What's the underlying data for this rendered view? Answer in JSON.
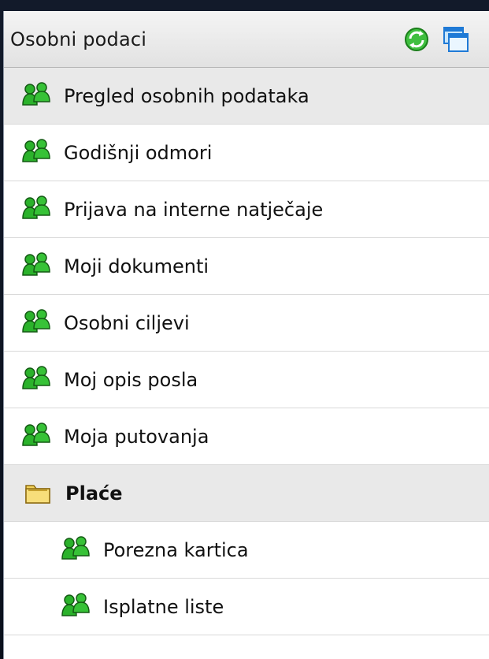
{
  "header": {
    "title": "Osobni podaci",
    "icons": [
      "refresh-icon",
      "window-icon"
    ]
  },
  "menu": {
    "items": [
      {
        "label": "Pregled osobnih podataka",
        "icon": "people-icon"
      },
      {
        "label": "Godišnji odmori",
        "icon": "people-icon"
      },
      {
        "label": "Prijava na interne natječaje",
        "icon": "people-icon"
      },
      {
        "label": "Moji dokumenti",
        "icon": "people-icon"
      },
      {
        "label": "Osobni ciljevi",
        "icon": "people-icon"
      },
      {
        "label": "Moj opis posla",
        "icon": "people-icon"
      },
      {
        "label": "Moja putovanja",
        "icon": "people-icon"
      }
    ],
    "folder": {
      "label": "Plaće",
      "icon": "folder-icon",
      "items": [
        {
          "label": "Porezna kartica",
          "icon": "people-icon"
        },
        {
          "label": "Isplatne liste",
          "icon": "people-icon"
        }
      ]
    }
  },
  "colors": {
    "header_bg": "#e6e6e6",
    "highlight_bg": "#e9e9e9",
    "icon_green": "#2aa12a",
    "folder_yellow": "#f2d35a"
  }
}
